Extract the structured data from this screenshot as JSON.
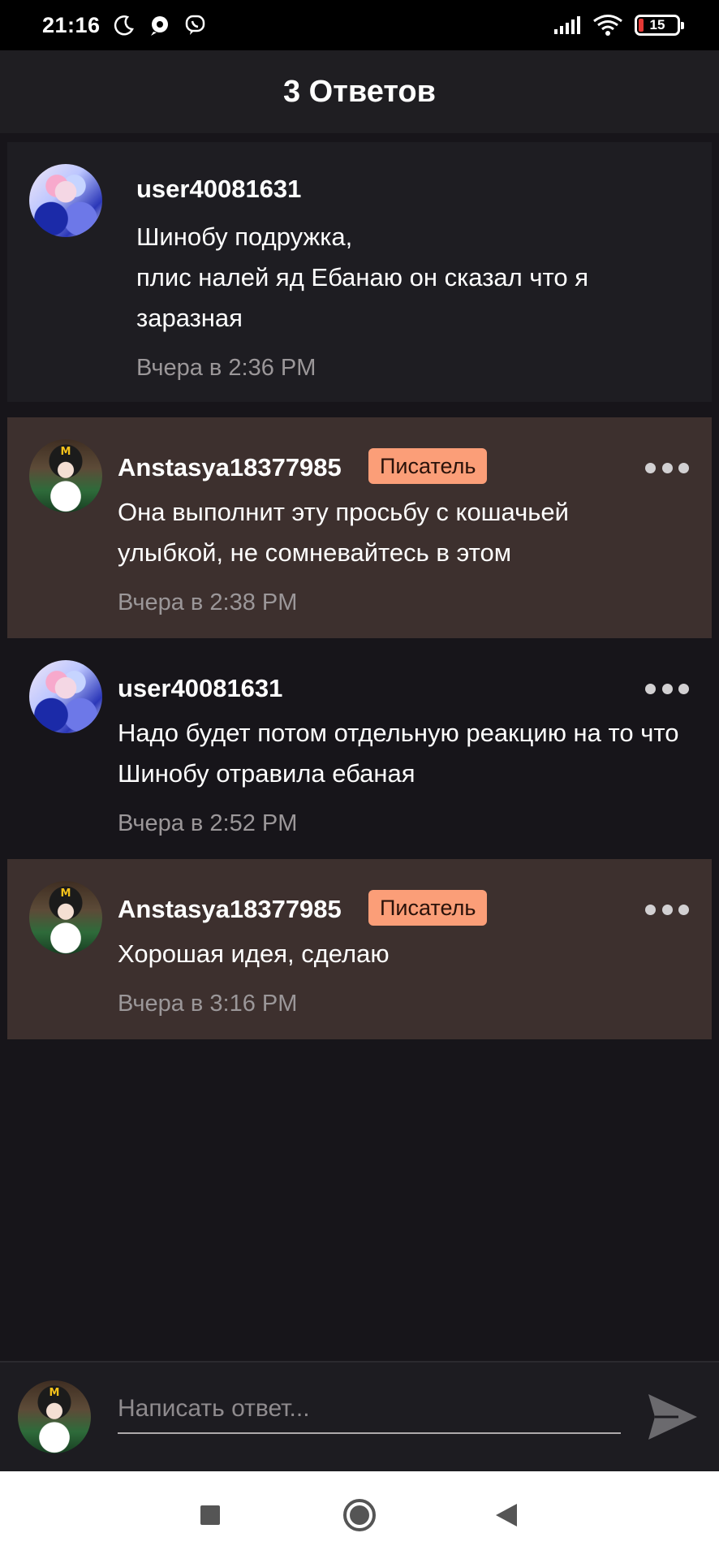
{
  "status_bar": {
    "time": "21:16",
    "left_icons": [
      "moon-icon",
      "chat-bubble-icon",
      "viber-icon"
    ],
    "right_icons": [
      "signal-icon",
      "wifi-icon",
      "battery-icon"
    ],
    "battery_level": "15",
    "battery_color": "#e53935"
  },
  "header": {
    "title": "3 Ответов"
  },
  "root_comment": {
    "username": "user40081631",
    "text": "Шинобу  подружка,\nплис налей яд Ебанаю он сказал что я заразная",
    "time": "Вчера в 2:36 PM"
  },
  "replies": [
    {
      "username": "Anstasya18377985",
      "badge": "Писатель",
      "text": "Она выполнит эту просьбу с кошачьей улыбкой, не сомневайтесь в этом",
      "time": "Вчера в 2:38 PM",
      "highlighted": true
    },
    {
      "username": "user40081631",
      "badge": "",
      "text": "Надо будет потом отдельную реакцию на то что Шинобу отравила ебаная",
      "time": "Вчера в 2:52 PM",
      "highlighted": false
    },
    {
      "username": "Anstasya18377985",
      "badge": "Писатель",
      "text": "Хорошая идея, сделаю",
      "time": "Вчера в 3:16 PM",
      "highlighted": true
    }
  ],
  "composer": {
    "placeholder": "Написать ответ...",
    "send_icon": "send-icon"
  },
  "colors": {
    "background": "#17151a",
    "header": "#1f1e22",
    "highlight": "#3d302e",
    "badge": "#fb9e78"
  },
  "nav_bar": {
    "buttons": [
      "recents-square-icon",
      "home-circle-icon",
      "back-triangle-icon"
    ]
  }
}
